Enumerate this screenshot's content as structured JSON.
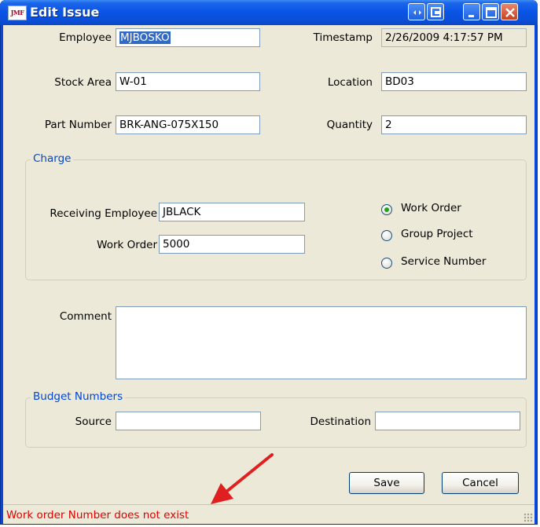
{
  "window": {
    "title": "Edit Issue",
    "icon_text": "JMF",
    "controls": [
      "resize-icon",
      "restore-icon",
      "minimize-icon",
      "maximize-icon",
      "close-icon"
    ]
  },
  "form": {
    "employee": {
      "label": "Employee",
      "value": "MJBOSKO"
    },
    "timestamp": {
      "label": "Timestamp",
      "value": "2/26/2009 4:17:57 PM"
    },
    "stock_area": {
      "label": "Stock Area",
      "value": "W-01"
    },
    "location": {
      "label": "Location",
      "value": "BD03"
    },
    "part_number": {
      "label": "Part Number",
      "value": "BRK-ANG-075X150"
    },
    "quantity": {
      "label": "Quantity",
      "value": "2"
    }
  },
  "charge": {
    "legend": "Charge",
    "receiving_employee": {
      "label": "Receiving Employee",
      "value": "JBLACK"
    },
    "work_order": {
      "label": "Work Order",
      "value": "5000"
    },
    "options": [
      {
        "label": "Work Order",
        "selected": true
      },
      {
        "label": "Group Project",
        "selected": false
      },
      {
        "label": "Service Number",
        "selected": false
      }
    ]
  },
  "comment": {
    "label": "Comment",
    "value": ""
  },
  "budget": {
    "legend": "Budget Numbers",
    "source": {
      "label": "Source",
      "value": ""
    },
    "destination": {
      "label": "Destination",
      "value": ""
    }
  },
  "buttons": {
    "save": "Save",
    "cancel": "Cancel"
  },
  "status": {
    "message": "Work order Number does not exist",
    "color": "#e00000"
  },
  "annotation": {
    "arrow_color": "#e02020"
  }
}
